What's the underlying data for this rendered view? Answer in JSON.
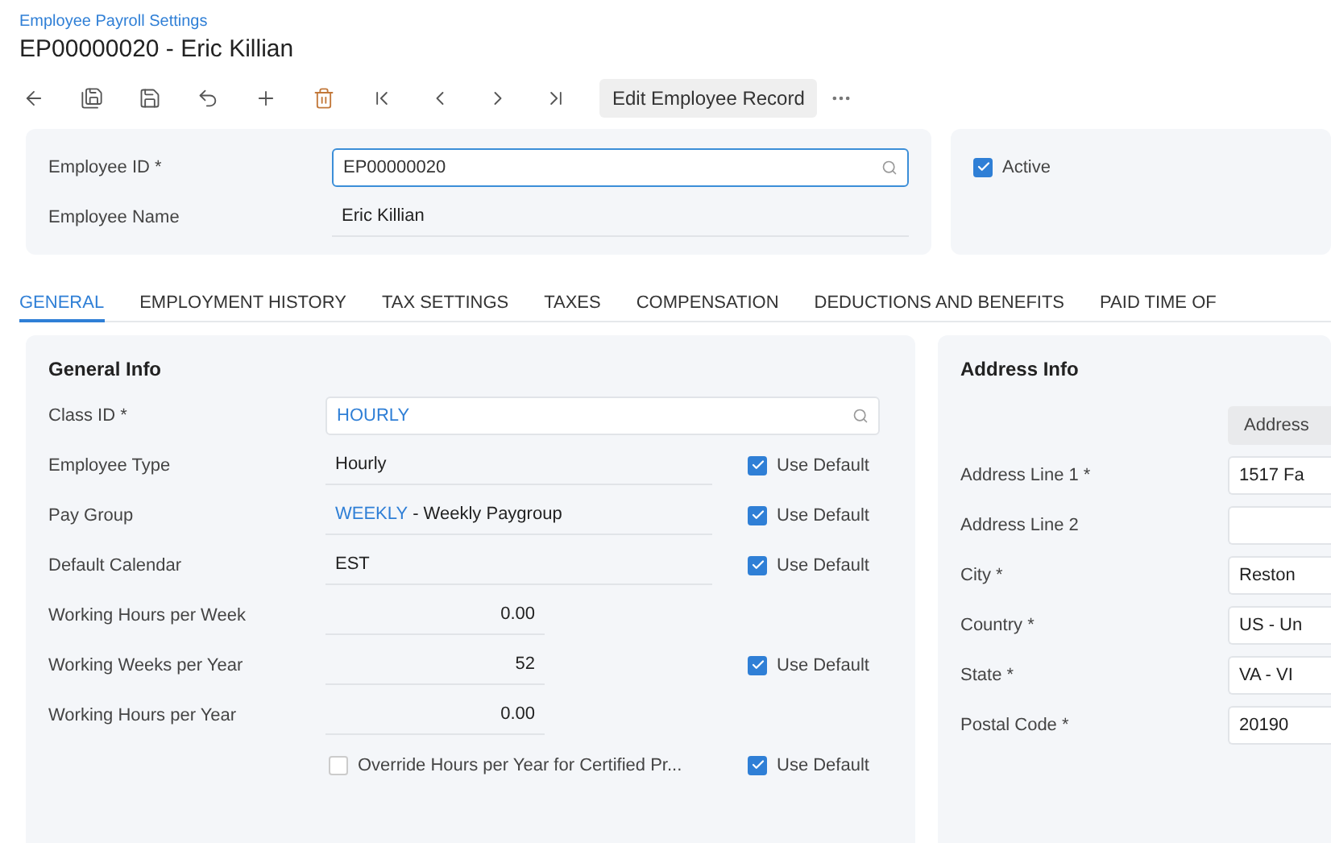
{
  "breadcrumb": "Employee Payroll Settings",
  "title": "EP00000020 - Eric Killian",
  "toolbar": {
    "action_button": "Edit Employee Record"
  },
  "summary": {
    "fields": [
      {
        "label": "Employee ID *",
        "value": "EP00000020",
        "kind": "lookup"
      },
      {
        "label": "Employee Name",
        "value": "Eric Killian",
        "kind": "text"
      }
    ],
    "active": {
      "label": "Active",
      "checked": true
    }
  },
  "tabs": [
    {
      "label": "GENERAL",
      "selected": true
    },
    {
      "label": "EMPLOYMENT HISTORY",
      "selected": false
    },
    {
      "label": "TAX SETTINGS",
      "selected": false
    },
    {
      "label": "TAXES",
      "selected": false
    },
    {
      "label": "COMPENSATION",
      "selected": false
    },
    {
      "label": "DEDUCTIONS AND BENEFITS",
      "selected": false
    },
    {
      "label": "PAID TIME OF",
      "selected": false
    }
  ],
  "general_info": {
    "title": "General Info",
    "rows": [
      {
        "kind": "lookup",
        "label": "Class ID *",
        "value_link": "HOURLY"
      },
      {
        "kind": "text",
        "label": "Employee Type",
        "value": "Hourly",
        "use_default": {
          "label": "Use Default",
          "checked": true
        }
      },
      {
        "kind": "text",
        "label": "Pay Group",
        "value_link": "WEEKLY",
        "value": " - Weekly Paygroup",
        "use_default": {
          "label": "Use Default",
          "checked": true
        }
      },
      {
        "kind": "text",
        "label": "Default Calendar",
        "value": "EST",
        "use_default": {
          "label": "Use Default",
          "checked": true
        }
      },
      {
        "kind": "number",
        "label": "Working Hours per Week",
        "value": "0.00"
      },
      {
        "kind": "number",
        "label": "Working Weeks per Year",
        "value": "52",
        "use_default": {
          "label": "Use Default",
          "checked": true
        }
      },
      {
        "kind": "number",
        "label": "Working Hours per Year",
        "value": "0.00"
      },
      {
        "kind": "checkbox",
        "label": "Override Hours per Year for Certified Pr...",
        "checked": false,
        "use_default": {
          "label": "Use Default",
          "checked": true
        }
      }
    ]
  },
  "address_info": {
    "title": "Address Info",
    "address_button": "Address",
    "rows": [
      {
        "label": "Address Line 1 *",
        "value": "1517 Fa"
      },
      {
        "label": "Address Line 2"
      },
      {
        "label": "City *",
        "value": "Reston"
      },
      {
        "label": "Country *",
        "value": "US - Un"
      },
      {
        "label": "State *",
        "value": "VA - VI"
      },
      {
        "label": "Postal Code *",
        "value": "20190"
      }
    ]
  }
}
